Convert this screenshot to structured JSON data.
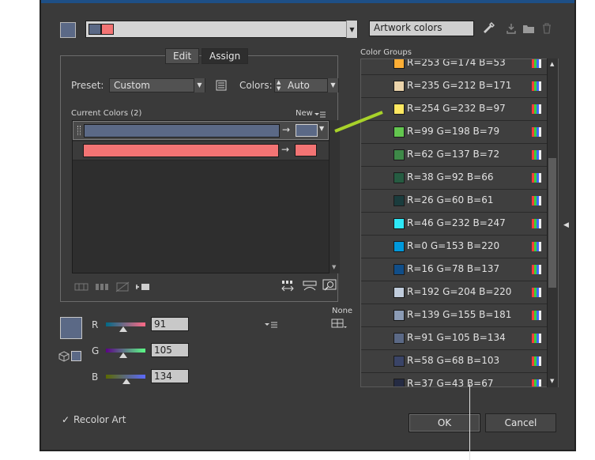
{
  "top": {
    "color_group_name": "Artwork colors"
  },
  "tabs": [
    {
      "label": "Edit"
    },
    {
      "label": "Assign"
    }
  ],
  "preset": {
    "label": "Preset:",
    "value": "Custom"
  },
  "colors_count": {
    "label": "Colors:",
    "value": "Auto"
  },
  "current_colors": {
    "title": "Current Colors (2)",
    "new_label": "New",
    "rows": [
      {
        "color": "#5b6986"
      },
      {
        "color": "#f37474"
      }
    ]
  },
  "sliders": {
    "none_label": "None",
    "channels": [
      {
        "label": "R",
        "value": "91"
      },
      {
        "label": "G",
        "value": "105"
      },
      {
        "label": "B",
        "value": "134"
      }
    ]
  },
  "color_groups": {
    "title": "Color Groups",
    "items": [
      {
        "label": "R=253 G=174 B=53",
        "color": "#fdae35"
      },
      {
        "label": "R=235 G=212 B=171",
        "color": "#ebd4ab"
      },
      {
        "label": "R=254 G=232 B=97",
        "color": "#fee861"
      },
      {
        "label": "R=99 G=198 B=79",
        "color": "#63c64f"
      },
      {
        "label": "R=62 G=137 B=72",
        "color": "#3e8948"
      },
      {
        "label": "R=38 G=92 B=66",
        "color": "#265c42"
      },
      {
        "label": "R=26 G=60 B=61",
        "color": "#1a3c3d"
      },
      {
        "label": "R=46 G=232 B=247",
        "color": "#2ee8f7"
      },
      {
        "label": "R=0 G=153 B=220",
        "color": "#0099dc"
      },
      {
        "label": "R=16 G=78 B=137",
        "color": "#104e89"
      },
      {
        "label": "R=192 G=204 B=220",
        "color": "#c0ccdc"
      },
      {
        "label": "R=139 G=155 B=181",
        "color": "#8b9bb5"
      },
      {
        "label": "R=91 G=105 B=134",
        "color": "#5b6986"
      },
      {
        "label": "R=58 G=68 B=103",
        "color": "#3a4467"
      },
      {
        "label": "R=37 G=43 B=67",
        "color": "#252b43"
      }
    ]
  },
  "recolor_art": {
    "label": "Recolor Art",
    "checked": true
  },
  "buttons": {
    "ok": "OK",
    "cancel": "Cancel"
  },
  "colors": {
    "background": "#3a3a3a",
    "accent_green": "#a8d22a"
  }
}
